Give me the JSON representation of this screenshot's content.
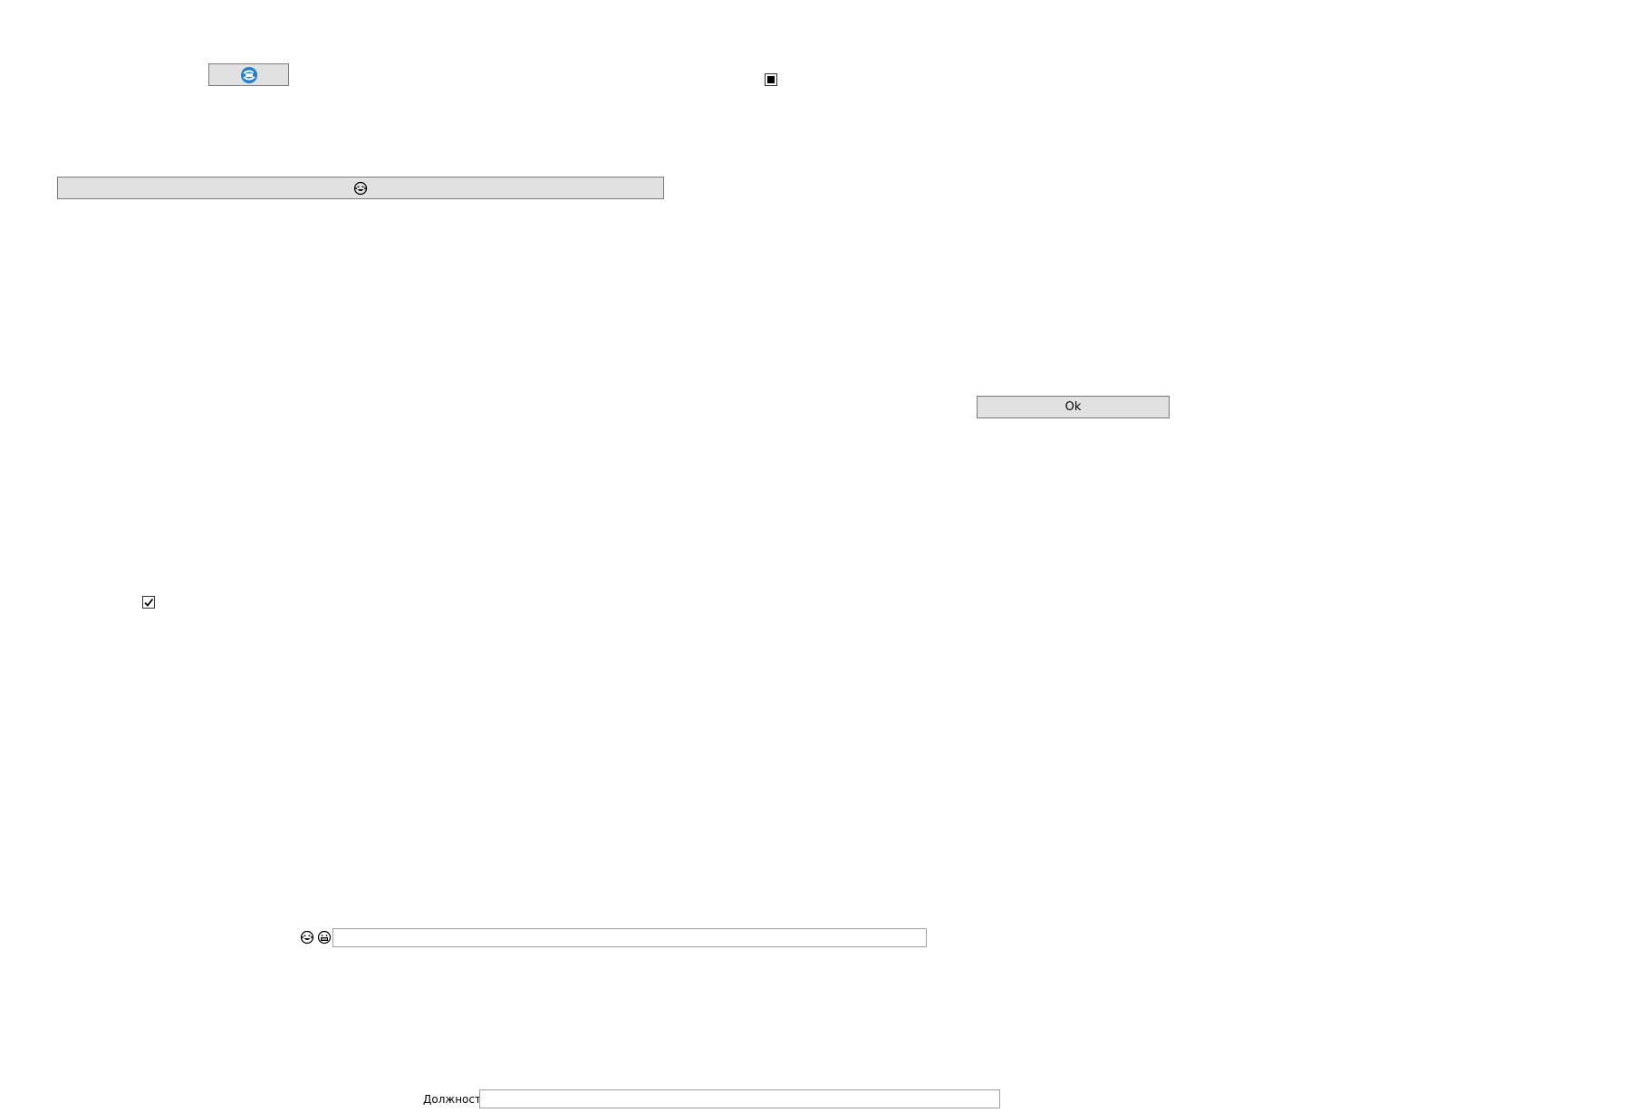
{
  "buttons": {
    "top_icon_button": {
      "icon": "refresh-globe-icon"
    },
    "wide_emoji_button": {
      "icon": "laughing-face-icon"
    },
    "ok_label": "Ok"
  },
  "checkboxes": {
    "top_right": {
      "state": "indeterminate"
    },
    "left": {
      "state": "checked"
    }
  },
  "emoji_row": {
    "icons": [
      "laughing-face-icon",
      "grinning-face-icon"
    ],
    "input_value": ""
  },
  "position_field": {
    "label": "Должность",
    "value": ""
  },
  "colors": {
    "button_bg": "#e1e1e1",
    "button_border": "#7a7a7a",
    "accent_blue": "#1f7fd1"
  }
}
